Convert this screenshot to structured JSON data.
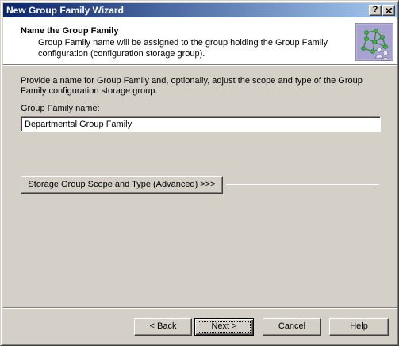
{
  "window": {
    "title": "New Group Family Wizard",
    "help_glyph": "?",
    "close_glyph": "X"
  },
  "header": {
    "title": "Name the Group Family",
    "subtitle": "Group Family name will be assigned to the group holding the Group Family configuration (configuration storage group).",
    "icon": "group-network-icon"
  },
  "body": {
    "intro": "Provide a name for Group Family and, optionally, adjust the scope and type of the Group Family configuration storage group.",
    "name_label": "Group Family name:",
    "name_value": "Departmental Group Family",
    "advanced_button": "Storage Group Scope and Type (Advanced) >>>"
  },
  "footer": {
    "back": "< Back",
    "next": "Next >",
    "cancel": "Cancel",
    "help": "Help"
  },
  "colors": {
    "titlebar_start": "#0a246a",
    "titlebar_end": "#a6caf0",
    "face": "#d4d0c8"
  }
}
